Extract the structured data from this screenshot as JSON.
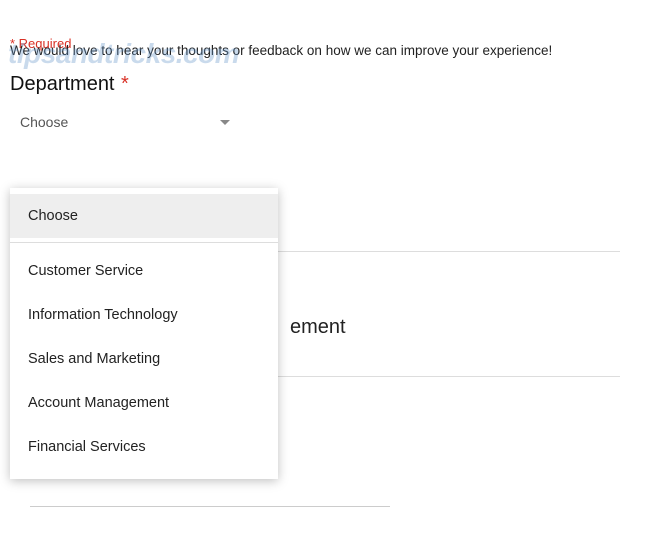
{
  "watermark": "tipsandtricks.com",
  "intro": "We would love to hear your thoughts or feedback on how we can improve your experience!",
  "required_note": "* Required",
  "question": {
    "label": "Department",
    "star": "*",
    "placeholder": "Choose"
  },
  "dropdown": {
    "options": [
      "Choose",
      "Customer Service",
      "Information Technology",
      "Sales and Marketing",
      "Account Management",
      "Financial Services"
    ]
  },
  "background_label_fragment": "ement"
}
